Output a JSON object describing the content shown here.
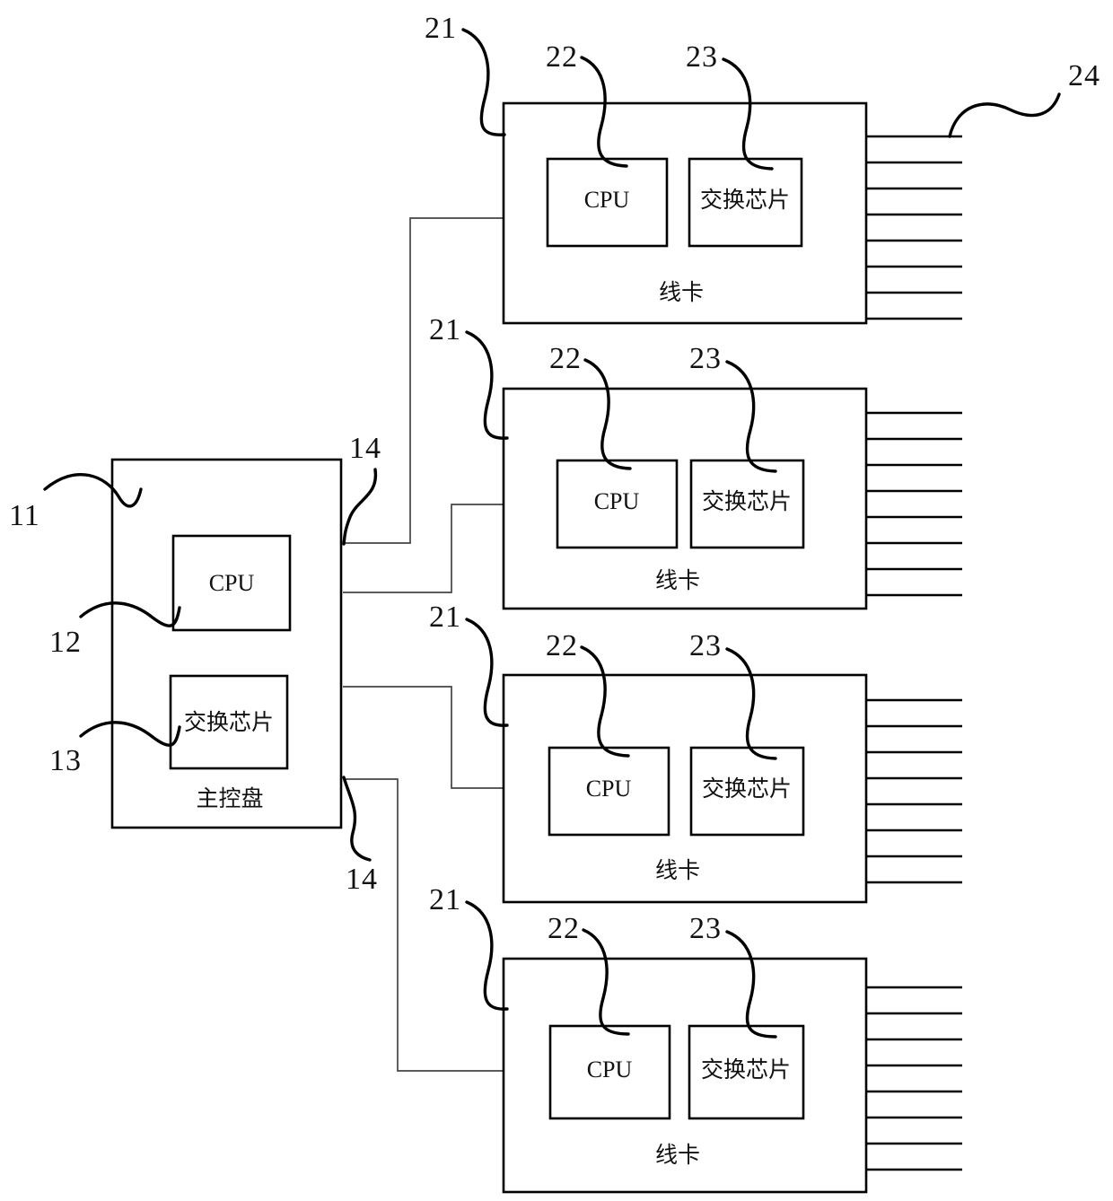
{
  "figure": {
    "type": "patent-block-diagram",
    "description": "Network switch chassis architecture: one main control board connected to four line cards",
    "background_color": "#ffffff",
    "line_color": "#000000"
  },
  "main_board": {
    "name": "main-control-board",
    "label": "主控盘",
    "ref": "11",
    "cpu": {
      "label": "CPU",
      "ref": "12"
    },
    "switch_chip": {
      "label": "交换芯片",
      "ref": "13"
    },
    "uplink_ref_top": "14",
    "uplink_ref_bottom": "14"
  },
  "line_cards": [
    {
      "index": 1,
      "label": "线卡",
      "ref": "21",
      "cpu": {
        "label": "CPU",
        "ref": "22"
      },
      "switch_chip": {
        "label": "交换芯片",
        "ref": "23"
      },
      "ports_ref": "24",
      "port_count": 8
    },
    {
      "index": 2,
      "label": "线卡",
      "ref": "21",
      "cpu": {
        "label": "CPU",
        "ref": "22"
      },
      "switch_chip": {
        "label": "交换芯片",
        "ref": "23"
      },
      "ports_ref": "",
      "port_count": 8
    },
    {
      "index": 3,
      "label": "线卡",
      "ref": "21",
      "cpu": {
        "label": "CPU",
        "ref": "22"
      },
      "switch_chip": {
        "label": "交换芯片",
        "ref": "23"
      },
      "ports_ref": "",
      "port_count": 8
    },
    {
      "index": 4,
      "label": "线卡",
      "ref": "21",
      "cpu": {
        "label": "CPU",
        "ref": "22"
      },
      "switch_chip": {
        "label": "交换芯片",
        "ref": "23"
      },
      "ports_ref": "",
      "port_count": 8
    }
  ]
}
